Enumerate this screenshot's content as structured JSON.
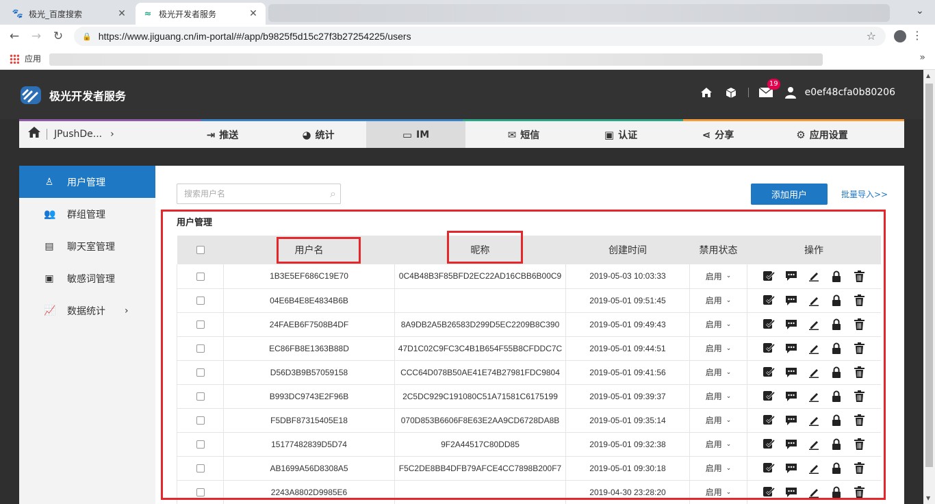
{
  "browser": {
    "tabs": [
      {
        "title": "极光_百度搜索",
        "active": false,
        "favicon": "paw-icon"
      },
      {
        "title": "极光开发者服务",
        "active": true,
        "favicon": "jiguang-logo-icon"
      }
    ],
    "url": "https://www.jiguang.cn/im-portal/#/app/b9825f5d15c27f3b27254225/users",
    "bookmarks_apps_label": "应用"
  },
  "header": {
    "brand": "极光开发者服务",
    "mail_badge": "19",
    "username": "e0ef48cfa0b80206"
  },
  "topnav": {
    "app_name": "JPushDe...",
    "items": [
      {
        "label": "推送",
        "icon": "push-icon"
      },
      {
        "label": "统计",
        "icon": "stats-icon"
      },
      {
        "label": "IM",
        "icon": "chat-icon",
        "active": true
      },
      {
        "label": "短信",
        "icon": "sms-icon"
      },
      {
        "label": "认证",
        "icon": "auth-icon"
      },
      {
        "label": "分享",
        "icon": "share-icon"
      },
      {
        "label": "应用设置",
        "icon": "gear-icon"
      }
    ],
    "stripe_colors": [
      "#8e5aa8",
      "#3a82c4",
      "#3a82c4",
      "#2aa58a",
      "#2aa58a",
      "#f29b38",
      "#f29b38"
    ]
  },
  "sidebar": {
    "items": [
      {
        "label": "用户管理",
        "icon": "user-icon",
        "active": true
      },
      {
        "label": "群组管理",
        "icon": "group-icon"
      },
      {
        "label": "聊天室管理",
        "icon": "chatroom-icon"
      },
      {
        "label": "敏感词管理",
        "icon": "sensitive-word-icon"
      },
      {
        "label": "数据统计",
        "icon": "chart-icon",
        "has_arrow": true
      }
    ]
  },
  "main": {
    "search_placeholder": "搜索用户名",
    "add_user_label": "添加用户",
    "bulk_import_label": "批量导入>>",
    "section_title": "用户管理",
    "columns": [
      "用户名",
      "昵称",
      "创建时间",
      "禁用状态",
      "操作"
    ],
    "rows": [
      {
        "username": "1B3E5EF686C19E70",
        "nickname": "0C4B48B3F85BFD2EC22AD16CBB6B00C9",
        "created": "2019-05-03 10:03:33",
        "status": "启用"
      },
      {
        "username": "04E6B4E8E4834B6B",
        "nickname": "",
        "created": "2019-05-01 09:51:45",
        "status": "启用"
      },
      {
        "username": "24FAEB6F7508B4DF",
        "nickname": "8A9DB2A5B26583D299D5EC2209B8C390",
        "created": "2019-05-01 09:49:43",
        "status": "启用"
      },
      {
        "username": "EC86FB8E1363B88D",
        "nickname": "47D1C02C9FC3C4B1B654F55B8CFDDC7C",
        "created": "2019-05-01 09:44:51",
        "status": "启用"
      },
      {
        "username": "D56D3B9B57059158",
        "nickname": "CCC64D078B50AE41E74B27981FDC9804",
        "created": "2019-05-01 09:41:56",
        "status": "启用"
      },
      {
        "username": "B993DC9743E2F96B",
        "nickname": "2C5DC929C191080C51A71581C6175199",
        "created": "2019-05-01 09:39:37",
        "status": "启用"
      },
      {
        "username": "F5DBF87315405E18",
        "nickname": "070D853B6606F8E63E2AA9CD6728DA8B",
        "created": "2019-05-01 09:35:14",
        "status": "启用"
      },
      {
        "username": "15177482839D5D74",
        "nickname": "9F2A44517C80DD85",
        "created": "2019-05-01 09:32:38",
        "status": "启用"
      },
      {
        "username": "AB1699A56D8308A5",
        "nickname": "F5C2DE8BB4DFB79AFCE4CC7898B200F7",
        "created": "2019-05-01 09:30:18",
        "status": "启用"
      },
      {
        "username": "2243A8802D9985E6",
        "nickname": "",
        "created": "2019-04-30 23:28:20",
        "status": "启用"
      }
    ],
    "row_actions": [
      "auth-icon",
      "message-icon",
      "edit-icon",
      "lock-icon",
      "delete-icon"
    ]
  },
  "colors": {
    "accent": "#1f78c3",
    "highlight_box": "#e5262a",
    "header_bg": "#333333"
  }
}
